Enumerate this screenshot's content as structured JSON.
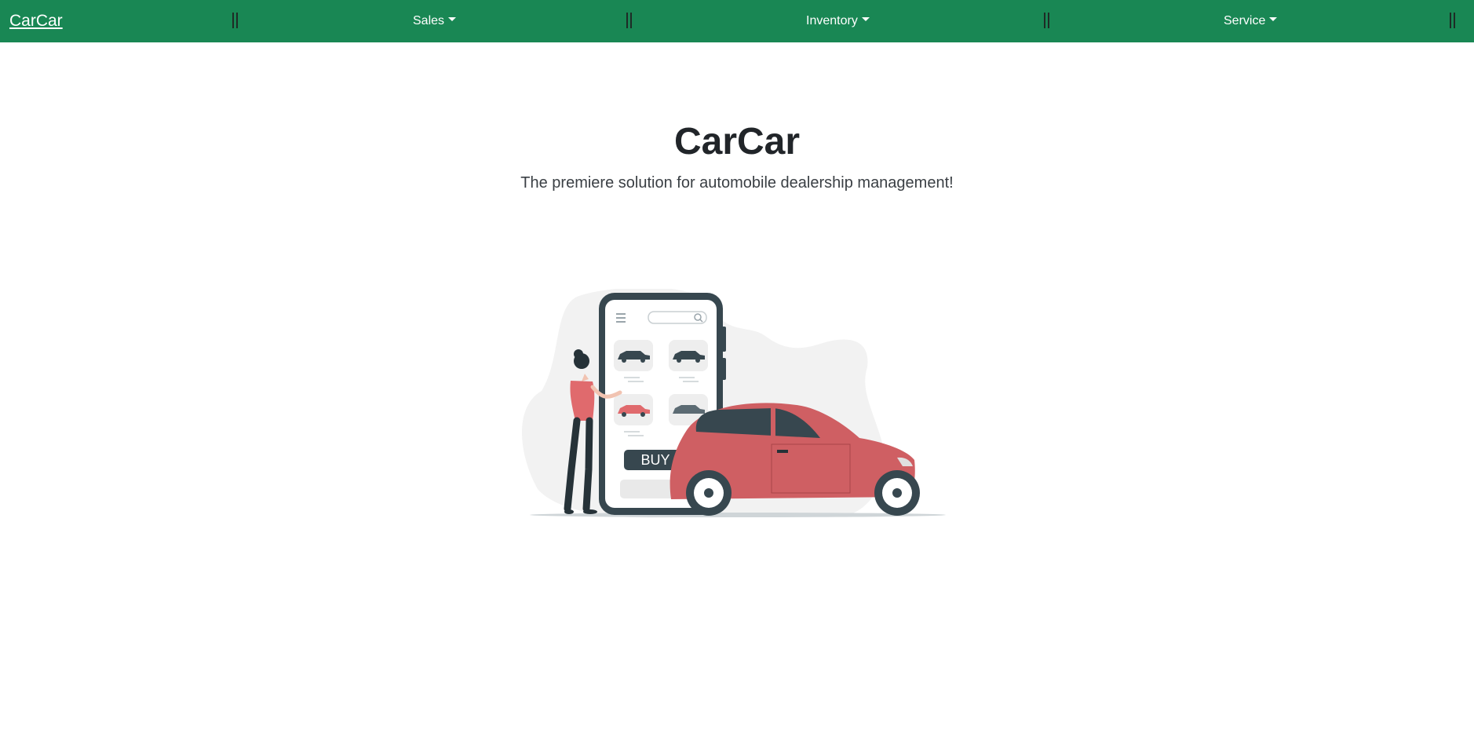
{
  "nav": {
    "brand": "CarCar",
    "items": [
      {
        "label": "Sales"
      },
      {
        "label": "Inventory"
      },
      {
        "label": "Service"
      }
    ],
    "separator": "||"
  },
  "hero": {
    "title": "CarCar",
    "subtitle": "The premiere solution for automobile dealership management!"
  },
  "illustration": {
    "button_text": "BUY"
  },
  "colors": {
    "navbar": "#198754",
    "car": "#cf5f63",
    "phone": "#37474f"
  }
}
